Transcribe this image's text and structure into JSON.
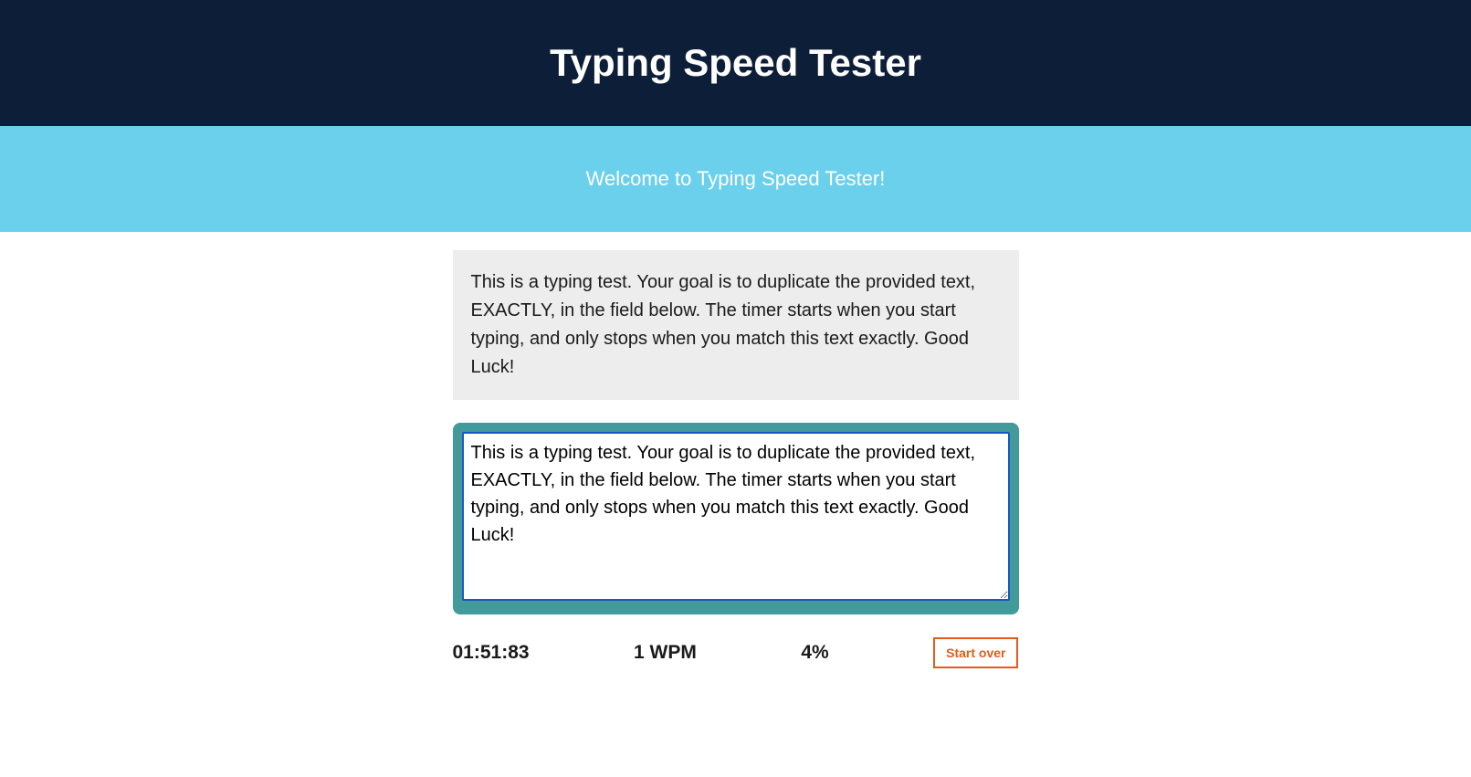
{
  "header": {
    "title": "Typing Speed Tester"
  },
  "subheader": {
    "welcome": "Welcome to Typing Speed Tester!"
  },
  "instructions": {
    "text": "This is a typing test. Your goal is to duplicate the provided text, EXACTLY, in the field below. The timer starts when you start typing, and only stops when you match this text exactly. Good Luck!"
  },
  "typing": {
    "value": "This is a typing test. Your goal is to duplicate the provided text, EXACTLY, in the field below. The timer starts when you start typing, and only stops when you match this text exactly. Good Luck!"
  },
  "stats": {
    "timer": "01:51:83",
    "wpm": "1 WPM",
    "accuracy": "4%",
    "start_over_label": "Start over"
  }
}
